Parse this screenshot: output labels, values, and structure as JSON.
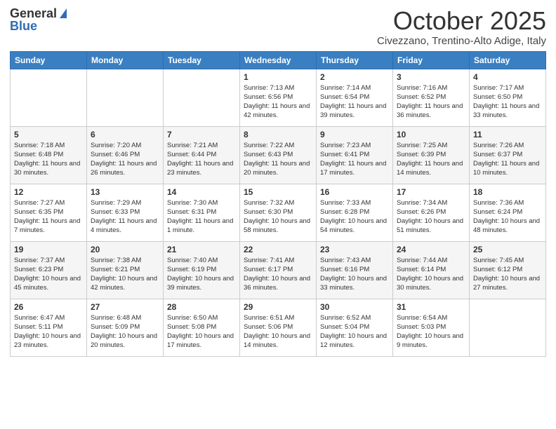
{
  "header": {
    "logo_general": "General",
    "logo_blue": "Blue",
    "month_title": "October 2025",
    "location": "Civezzano, Trentino-Alto Adige, Italy"
  },
  "days_of_week": [
    "Sunday",
    "Monday",
    "Tuesday",
    "Wednesday",
    "Thursday",
    "Friday",
    "Saturday"
  ],
  "weeks": [
    [
      {
        "day": "",
        "text": ""
      },
      {
        "day": "",
        "text": ""
      },
      {
        "day": "",
        "text": ""
      },
      {
        "day": "1",
        "text": "Sunrise: 7:13 AM\nSunset: 6:56 PM\nDaylight: 11 hours and 42 minutes."
      },
      {
        "day": "2",
        "text": "Sunrise: 7:14 AM\nSunset: 6:54 PM\nDaylight: 11 hours and 39 minutes."
      },
      {
        "day": "3",
        "text": "Sunrise: 7:16 AM\nSunset: 6:52 PM\nDaylight: 11 hours and 36 minutes."
      },
      {
        "day": "4",
        "text": "Sunrise: 7:17 AM\nSunset: 6:50 PM\nDaylight: 11 hours and 33 minutes."
      }
    ],
    [
      {
        "day": "5",
        "text": "Sunrise: 7:18 AM\nSunset: 6:48 PM\nDaylight: 11 hours and 30 minutes."
      },
      {
        "day": "6",
        "text": "Sunrise: 7:20 AM\nSunset: 6:46 PM\nDaylight: 11 hours and 26 minutes."
      },
      {
        "day": "7",
        "text": "Sunrise: 7:21 AM\nSunset: 6:44 PM\nDaylight: 11 hours and 23 minutes."
      },
      {
        "day": "8",
        "text": "Sunrise: 7:22 AM\nSunset: 6:43 PM\nDaylight: 11 hours and 20 minutes."
      },
      {
        "day": "9",
        "text": "Sunrise: 7:23 AM\nSunset: 6:41 PM\nDaylight: 11 hours and 17 minutes."
      },
      {
        "day": "10",
        "text": "Sunrise: 7:25 AM\nSunset: 6:39 PM\nDaylight: 11 hours and 14 minutes."
      },
      {
        "day": "11",
        "text": "Sunrise: 7:26 AM\nSunset: 6:37 PM\nDaylight: 11 hours and 10 minutes."
      }
    ],
    [
      {
        "day": "12",
        "text": "Sunrise: 7:27 AM\nSunset: 6:35 PM\nDaylight: 11 hours and 7 minutes."
      },
      {
        "day": "13",
        "text": "Sunrise: 7:29 AM\nSunset: 6:33 PM\nDaylight: 11 hours and 4 minutes."
      },
      {
        "day": "14",
        "text": "Sunrise: 7:30 AM\nSunset: 6:31 PM\nDaylight: 11 hours and 1 minute."
      },
      {
        "day": "15",
        "text": "Sunrise: 7:32 AM\nSunset: 6:30 PM\nDaylight: 10 hours and 58 minutes."
      },
      {
        "day": "16",
        "text": "Sunrise: 7:33 AM\nSunset: 6:28 PM\nDaylight: 10 hours and 54 minutes."
      },
      {
        "day": "17",
        "text": "Sunrise: 7:34 AM\nSunset: 6:26 PM\nDaylight: 10 hours and 51 minutes."
      },
      {
        "day": "18",
        "text": "Sunrise: 7:36 AM\nSunset: 6:24 PM\nDaylight: 10 hours and 48 minutes."
      }
    ],
    [
      {
        "day": "19",
        "text": "Sunrise: 7:37 AM\nSunset: 6:23 PM\nDaylight: 10 hours and 45 minutes."
      },
      {
        "day": "20",
        "text": "Sunrise: 7:38 AM\nSunset: 6:21 PM\nDaylight: 10 hours and 42 minutes."
      },
      {
        "day": "21",
        "text": "Sunrise: 7:40 AM\nSunset: 6:19 PM\nDaylight: 10 hours and 39 minutes."
      },
      {
        "day": "22",
        "text": "Sunrise: 7:41 AM\nSunset: 6:17 PM\nDaylight: 10 hours and 36 minutes."
      },
      {
        "day": "23",
        "text": "Sunrise: 7:43 AM\nSunset: 6:16 PM\nDaylight: 10 hours and 33 minutes."
      },
      {
        "day": "24",
        "text": "Sunrise: 7:44 AM\nSunset: 6:14 PM\nDaylight: 10 hours and 30 minutes."
      },
      {
        "day": "25",
        "text": "Sunrise: 7:45 AM\nSunset: 6:12 PM\nDaylight: 10 hours and 27 minutes."
      }
    ],
    [
      {
        "day": "26",
        "text": "Sunrise: 6:47 AM\nSunset: 5:11 PM\nDaylight: 10 hours and 23 minutes."
      },
      {
        "day": "27",
        "text": "Sunrise: 6:48 AM\nSunset: 5:09 PM\nDaylight: 10 hours and 20 minutes."
      },
      {
        "day": "28",
        "text": "Sunrise: 6:50 AM\nSunset: 5:08 PM\nDaylight: 10 hours and 17 minutes."
      },
      {
        "day": "29",
        "text": "Sunrise: 6:51 AM\nSunset: 5:06 PM\nDaylight: 10 hours and 14 minutes."
      },
      {
        "day": "30",
        "text": "Sunrise: 6:52 AM\nSunset: 5:04 PM\nDaylight: 10 hours and 12 minutes."
      },
      {
        "day": "31",
        "text": "Sunrise: 6:54 AM\nSunset: 5:03 PM\nDaylight: 10 hours and 9 minutes."
      },
      {
        "day": "",
        "text": ""
      }
    ]
  ]
}
